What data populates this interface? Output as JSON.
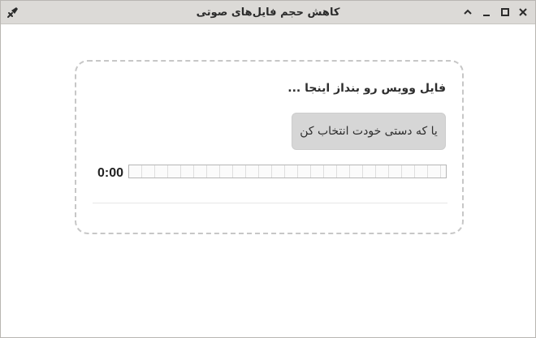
{
  "window": {
    "title": "کاهش حجم فایل‌های صوتی",
    "controls": [
      "pin-icon",
      "chevron-up-icon",
      "minimize-icon",
      "maximize-icon",
      "close-icon"
    ]
  },
  "drop_zone": {
    "prompt": "فایل وویس رو بنداز اینجا ...",
    "select_button_label": "یا که دستی خودت انتخاب کن"
  },
  "player": {
    "time": "0:00",
    "progress": 0
  },
  "colors": {
    "titlebar": "#dcdad7",
    "button": "#d6d6d6",
    "dashed_border": "#c7c7c7"
  }
}
